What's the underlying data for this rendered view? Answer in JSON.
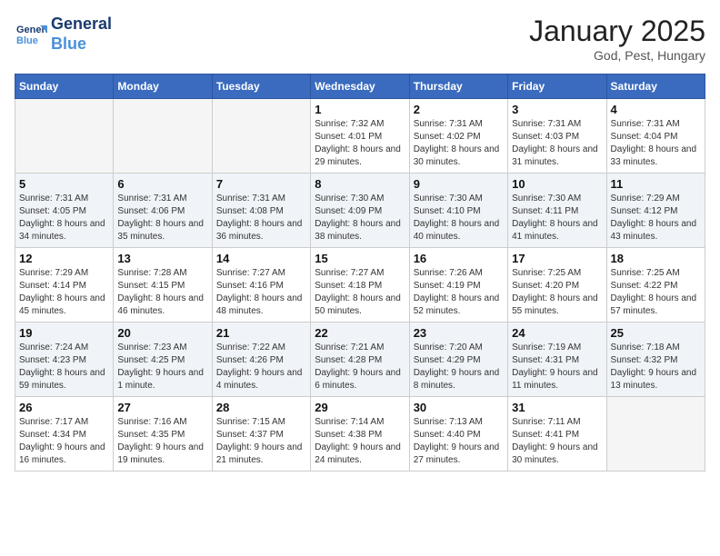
{
  "header": {
    "logo_line1": "General",
    "logo_line2": "Blue",
    "month": "January 2025",
    "location": "God, Pest, Hungary"
  },
  "weekdays": [
    "Sunday",
    "Monday",
    "Tuesday",
    "Wednesday",
    "Thursday",
    "Friday",
    "Saturday"
  ],
  "weeks": [
    [
      {
        "day": "",
        "info": ""
      },
      {
        "day": "",
        "info": ""
      },
      {
        "day": "",
        "info": ""
      },
      {
        "day": "1",
        "info": "Sunrise: 7:32 AM\nSunset: 4:01 PM\nDaylight: 8 hours and 29 minutes."
      },
      {
        "day": "2",
        "info": "Sunrise: 7:31 AM\nSunset: 4:02 PM\nDaylight: 8 hours and 30 minutes."
      },
      {
        "day": "3",
        "info": "Sunrise: 7:31 AM\nSunset: 4:03 PM\nDaylight: 8 hours and 31 minutes."
      },
      {
        "day": "4",
        "info": "Sunrise: 7:31 AM\nSunset: 4:04 PM\nDaylight: 8 hours and 33 minutes."
      }
    ],
    [
      {
        "day": "5",
        "info": "Sunrise: 7:31 AM\nSunset: 4:05 PM\nDaylight: 8 hours and 34 minutes."
      },
      {
        "day": "6",
        "info": "Sunrise: 7:31 AM\nSunset: 4:06 PM\nDaylight: 8 hours and 35 minutes."
      },
      {
        "day": "7",
        "info": "Sunrise: 7:31 AM\nSunset: 4:08 PM\nDaylight: 8 hours and 36 minutes."
      },
      {
        "day": "8",
        "info": "Sunrise: 7:30 AM\nSunset: 4:09 PM\nDaylight: 8 hours and 38 minutes."
      },
      {
        "day": "9",
        "info": "Sunrise: 7:30 AM\nSunset: 4:10 PM\nDaylight: 8 hours and 40 minutes."
      },
      {
        "day": "10",
        "info": "Sunrise: 7:30 AM\nSunset: 4:11 PM\nDaylight: 8 hours and 41 minutes."
      },
      {
        "day": "11",
        "info": "Sunrise: 7:29 AM\nSunset: 4:12 PM\nDaylight: 8 hours and 43 minutes."
      }
    ],
    [
      {
        "day": "12",
        "info": "Sunrise: 7:29 AM\nSunset: 4:14 PM\nDaylight: 8 hours and 45 minutes."
      },
      {
        "day": "13",
        "info": "Sunrise: 7:28 AM\nSunset: 4:15 PM\nDaylight: 8 hours and 46 minutes."
      },
      {
        "day": "14",
        "info": "Sunrise: 7:27 AM\nSunset: 4:16 PM\nDaylight: 8 hours and 48 minutes."
      },
      {
        "day": "15",
        "info": "Sunrise: 7:27 AM\nSunset: 4:18 PM\nDaylight: 8 hours and 50 minutes."
      },
      {
        "day": "16",
        "info": "Sunrise: 7:26 AM\nSunset: 4:19 PM\nDaylight: 8 hours and 52 minutes."
      },
      {
        "day": "17",
        "info": "Sunrise: 7:25 AM\nSunset: 4:20 PM\nDaylight: 8 hours and 55 minutes."
      },
      {
        "day": "18",
        "info": "Sunrise: 7:25 AM\nSunset: 4:22 PM\nDaylight: 8 hours and 57 minutes."
      }
    ],
    [
      {
        "day": "19",
        "info": "Sunrise: 7:24 AM\nSunset: 4:23 PM\nDaylight: 8 hours and 59 minutes."
      },
      {
        "day": "20",
        "info": "Sunrise: 7:23 AM\nSunset: 4:25 PM\nDaylight: 9 hours and 1 minute."
      },
      {
        "day": "21",
        "info": "Sunrise: 7:22 AM\nSunset: 4:26 PM\nDaylight: 9 hours and 4 minutes."
      },
      {
        "day": "22",
        "info": "Sunrise: 7:21 AM\nSunset: 4:28 PM\nDaylight: 9 hours and 6 minutes."
      },
      {
        "day": "23",
        "info": "Sunrise: 7:20 AM\nSunset: 4:29 PM\nDaylight: 9 hours and 8 minutes."
      },
      {
        "day": "24",
        "info": "Sunrise: 7:19 AM\nSunset: 4:31 PM\nDaylight: 9 hours and 11 minutes."
      },
      {
        "day": "25",
        "info": "Sunrise: 7:18 AM\nSunset: 4:32 PM\nDaylight: 9 hours and 13 minutes."
      }
    ],
    [
      {
        "day": "26",
        "info": "Sunrise: 7:17 AM\nSunset: 4:34 PM\nDaylight: 9 hours and 16 minutes."
      },
      {
        "day": "27",
        "info": "Sunrise: 7:16 AM\nSunset: 4:35 PM\nDaylight: 9 hours and 19 minutes."
      },
      {
        "day": "28",
        "info": "Sunrise: 7:15 AM\nSunset: 4:37 PM\nDaylight: 9 hours and 21 minutes."
      },
      {
        "day": "29",
        "info": "Sunrise: 7:14 AM\nSunset: 4:38 PM\nDaylight: 9 hours and 24 minutes."
      },
      {
        "day": "30",
        "info": "Sunrise: 7:13 AM\nSunset: 4:40 PM\nDaylight: 9 hours and 27 minutes."
      },
      {
        "day": "31",
        "info": "Sunrise: 7:11 AM\nSunset: 4:41 PM\nDaylight: 9 hours and 30 minutes."
      },
      {
        "day": "",
        "info": ""
      }
    ]
  ]
}
